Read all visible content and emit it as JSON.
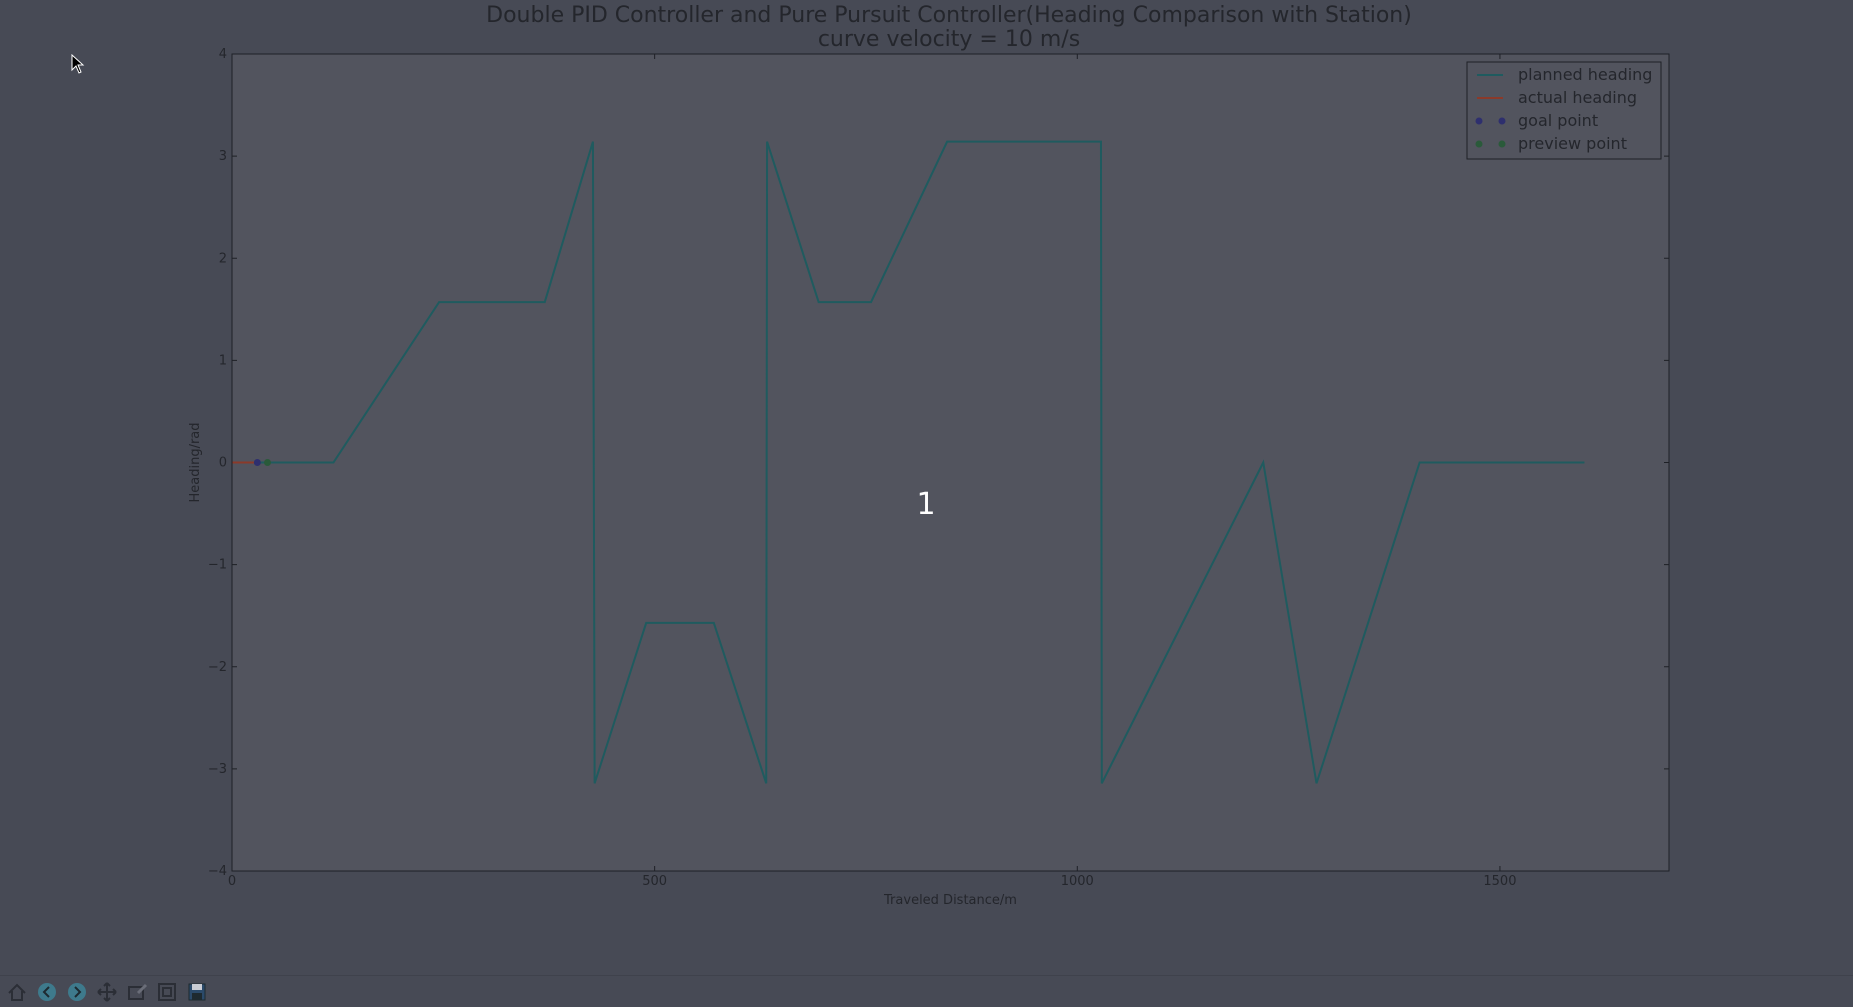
{
  "figure": {
    "title_line1": "Double PID Controller and Pure Pursuit Controller(Heading Comparison with Station)",
    "title_line2": "curve velocity = 10 m/s",
    "center_label": "1"
  },
  "toolbar": [
    {
      "name": "home-icon",
      "label": "home"
    },
    {
      "name": "back-icon",
      "label": "back"
    },
    {
      "name": "forward-icon",
      "label": "forward"
    },
    {
      "name": "pan-icon",
      "label": "pan"
    },
    {
      "name": "zoom-icon",
      "label": "zoom"
    },
    {
      "name": "configure-subplots-icon",
      "label": "configure subplots"
    },
    {
      "name": "save-icon",
      "label": "save"
    }
  ],
  "colors": {
    "planned": "#1f5b5f",
    "actual": "#8b3a2a",
    "goal": "#2e2f6e",
    "preview": "#2a5a3a",
    "axes_bg": "#52545e",
    "text": "#24262c"
  },
  "chart_data": {
    "type": "line",
    "title": "Double PID Controller and Pure Pursuit Controller(Heading Comparison with Station)\ncurve velocity = 10 m/s",
    "xlabel": "Traveled Distance/m",
    "ylabel": "Heading/rad",
    "xlim": [
      0,
      1700
    ],
    "ylim": [
      -4,
      4
    ],
    "xticks": [
      0,
      500,
      1000,
      1500
    ],
    "yticks": [
      4,
      3,
      2,
      1,
      0,
      -1,
      -2,
      -3,
      -4
    ],
    "ytick_labels": [
      "4",
      "3",
      "2",
      "1",
      "0",
      "−1",
      "−2",
      "−3",
      "−4"
    ],
    "grid": false,
    "legend_position": "top-right",
    "series": [
      {
        "name": "planned heading",
        "kind": "line",
        "color": "#1f5b5f",
        "x": [
          0,
          120,
          245,
          370,
          427,
          429,
          490,
          570,
          632,
          633,
          694,
          756,
          846,
          1028,
          1029,
          1220,
          1283,
          1405,
          1600
        ],
        "y": [
          0,
          0,
          1.5708,
          1.5708,
          3.1416,
          -3.1416,
          -1.5708,
          -1.5708,
          -3.1416,
          3.1416,
          1.5708,
          1.5708,
          3.1416,
          3.1416,
          -3.1416,
          0,
          -3.1416,
          0,
          0
        ]
      },
      {
        "name": "actual heading",
        "kind": "line",
        "color": "#8b3a2a",
        "x": [
          0,
          30
        ],
        "y": [
          0,
          0
        ]
      },
      {
        "name": "goal point",
        "kind": "point",
        "color": "#2e2f6e",
        "x": [
          30
        ],
        "y": [
          0
        ]
      },
      {
        "name": "preview point",
        "kind": "point",
        "color": "#2a5a3a",
        "x": [
          42
        ],
        "y": [
          0
        ]
      }
    ]
  }
}
